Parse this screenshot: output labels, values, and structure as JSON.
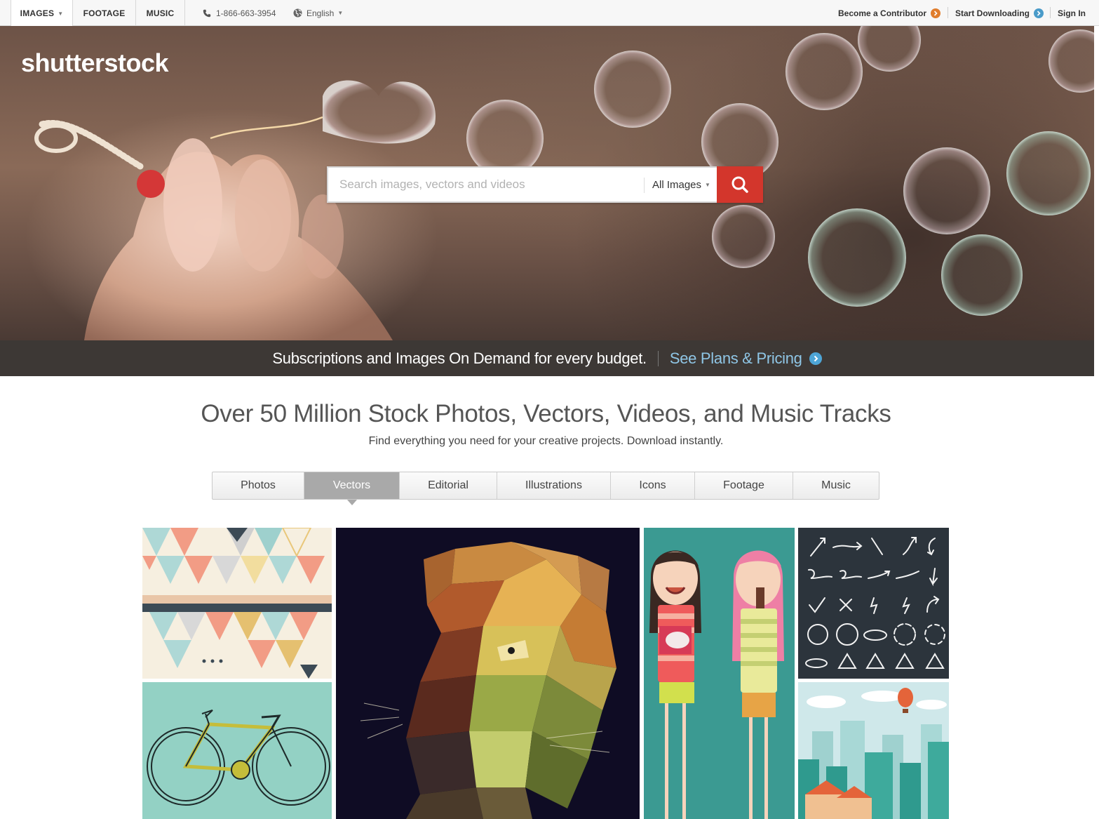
{
  "topnav": {
    "tabs": [
      {
        "label": "IMAGES",
        "has_caret": true,
        "active": true
      },
      {
        "label": "FOOTAGE"
      },
      {
        "label": "MUSIC"
      }
    ],
    "phone": "1-866-663-3954",
    "language": "English",
    "become_contributor": "Become a Contributor",
    "start_downloading": "Start Downloading",
    "sign_in": "Sign In",
    "colors": {
      "contributor_arrow": "#e07d2d",
      "download_arrow": "#4a9bc9"
    }
  },
  "hero": {
    "logo": "shutterstock",
    "search": {
      "placeholder": "Search images, vectors and videos",
      "value": "",
      "type_selected": "All Images",
      "button_icon": "search-icon",
      "button_color": "#d3362c"
    }
  },
  "promo": {
    "message": "Subscriptions and Images On Demand for every budget.",
    "link": "See Plans & Pricing",
    "link_color": "#8fc6e6"
  },
  "main": {
    "headline": "Over 50 Million Stock Photos, Vectors, Videos, and Music Tracks",
    "subheadline": "Find everything you need for your creative projects. Download instantly.",
    "category_tabs": [
      {
        "label": "Photos"
      },
      {
        "label": "Vectors",
        "active": true
      },
      {
        "label": "Editorial"
      },
      {
        "label": "Illustrations"
      },
      {
        "label": "Icons"
      },
      {
        "label": "Footage"
      },
      {
        "label": "Music"
      }
    ]
  },
  "gallery": {
    "tiles": [
      {
        "name": "geometric-triangles-pattern"
      },
      {
        "name": "low-poly-tiger"
      },
      {
        "name": "two-girls-illustration"
      },
      {
        "name": "hand-drawn-arrows-set"
      },
      {
        "name": "vintage-bicycle"
      },
      {
        "name": "city-skyline-balloon"
      }
    ]
  }
}
